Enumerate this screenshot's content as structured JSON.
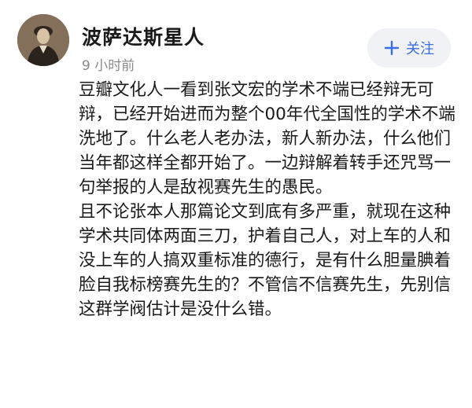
{
  "post": {
    "author": {
      "name": "波萨达斯星人",
      "time": "9 小时前",
      "avatar_icon": "profile-photo"
    },
    "follow_button": {
      "icon": "plus-icon",
      "label": "关注",
      "color": "#3a6ee6",
      "background": "#f1f2f6"
    },
    "paragraphs": [
      "豆瓣文化人一看到张文宏的学术不端已经辩无可辩，已经开始进而为整个00年代全国性的学术不端洗地了。什么老人老办法，新人新办法，什么他们当年都这样全都开始了。一边辩解着转手还咒骂一句举报的人是敌视赛先生的愚民。",
      "且不论张本人那篇论文到底有多严重，就现在这种学术共同体两面三刀，护着自己人，对上车的人和没上车的人搞双重标准的德行，是有什么胆量腆着脸自我标榜赛先生的？不管信不信赛先生，先别信这群学阀估计是没什么错。"
    ]
  }
}
